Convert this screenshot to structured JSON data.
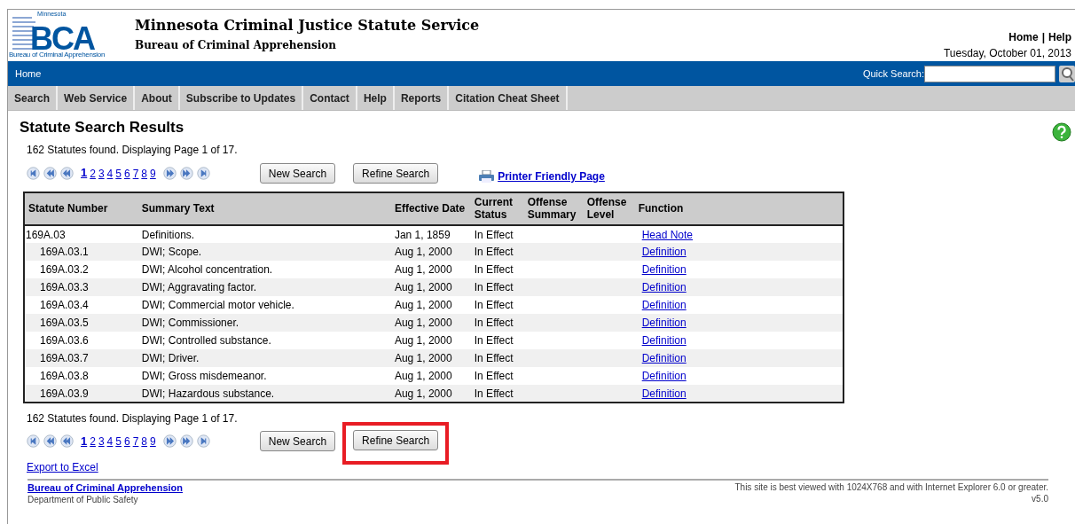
{
  "header": {
    "logo": {
      "top": "Minnesota",
      "letters": "BCA",
      "bottom": "Bureau of Criminal Apprehension"
    },
    "title": "Minnesota Criminal Justice Statute Service",
    "subtitle": "Bureau of Criminal Apprehension",
    "links": [
      "Home",
      "Help"
    ],
    "separator": "|",
    "date": "Tuesday, October 01, 2013"
  },
  "blue_bar": {
    "breadcrumb": "Home",
    "quick_search_label": "Quick Search:"
  },
  "menu": [
    {
      "label": "Search"
    },
    {
      "label": "Web Service"
    },
    {
      "label": "About"
    },
    {
      "label": "Subscribe to Updates"
    },
    {
      "label": "Contact"
    },
    {
      "label": "Help"
    },
    {
      "label": "Reports"
    },
    {
      "label": "Citation Cheat Sheet"
    }
  ],
  "heading": "Statute Search Results",
  "summary_top": "162 Statutes found. Displaying Page 1 of 17.",
  "pages_top": [
    {
      "label": "1",
      "selected": true
    },
    {
      "label": "2",
      "selected": false
    },
    {
      "label": "3",
      "selected": false
    },
    {
      "label": "4",
      "selected": false
    },
    {
      "label": "5",
      "selected": false
    },
    {
      "label": "6",
      "selected": false
    },
    {
      "label": "7",
      "selected": false
    },
    {
      "label": "8",
      "selected": false
    },
    {
      "label": "9",
      "selected": false
    }
  ],
  "buttons_top": [
    {
      "label": "New Search",
      "highlighted": false
    },
    {
      "label": "Refine Search",
      "highlighted": false
    }
  ],
  "printer_link": "Printer Friendly Page",
  "table": {
    "columns": [
      "Statute Number",
      "Summary Text",
      "Effective Date",
      "Current Status",
      "Offense Summary",
      "Offense Level",
      "Function"
    ],
    "rows": [
      {
        "number": "169A.03",
        "summary": "Definitions.",
        "date": "Jan 1, 1859",
        "status": "In Effect",
        "function": "Head Note",
        "children": [
          {
            "number": "169A.03.1",
            "summary": "DWI; Scope.",
            "date": "Aug 1, 2000",
            "status": "In Effect",
            "function": "Definition"
          },
          {
            "number": "169A.03.2",
            "summary": "DWI; Alcohol concentration.",
            "date": "Aug 1, 2000",
            "status": "In Effect",
            "function": "Definition"
          },
          {
            "number": "169A.03.3",
            "summary": "DWI; Aggravating factor.",
            "date": "Aug 1, 2000",
            "status": "In Effect",
            "function": "Definition"
          },
          {
            "number": "169A.03.4",
            "summary": "DWI; Commercial motor vehicle.",
            "date": "Aug 1, 2000",
            "status": "In Effect",
            "function": "Definition"
          },
          {
            "number": "169A.03.5",
            "summary": "DWI; Commissioner.",
            "date": "Aug 1, 2000",
            "status": "In Effect",
            "function": "Definition"
          },
          {
            "number": "169A.03.6",
            "summary": "DWI; Controlled substance.",
            "date": "Aug 1, 2000",
            "status": "In Effect",
            "function": "Definition"
          },
          {
            "number": "169A.03.7",
            "summary": "DWI; Driver.",
            "date": "Aug 1, 2000",
            "status": "In Effect",
            "function": "Definition"
          },
          {
            "number": "169A.03.8",
            "summary": "DWI; Gross misdemeanor.",
            "date": "Aug 1, 2000",
            "status": "In Effect",
            "function": "Definition"
          },
          {
            "number": "169A.03.9",
            "summary": "DWI; Hazardous substance.",
            "date": "Aug 1, 2000",
            "status": "In Effect",
            "function": "Definition"
          }
        ]
      }
    ]
  },
  "summary_bottom": "162 Statutes found. Displaying Page 1 of 17.",
  "pages_bottom": [
    {
      "label": "1",
      "selected": true
    },
    {
      "label": "2",
      "selected": false
    },
    {
      "label": "3",
      "selected": false
    },
    {
      "label": "4",
      "selected": false
    },
    {
      "label": "5",
      "selected": false
    },
    {
      "label": "6",
      "selected": false
    },
    {
      "label": "7",
      "selected": false
    },
    {
      "label": "8",
      "selected": false
    },
    {
      "label": "9",
      "selected": false
    }
  ],
  "buttons_bottom": [
    {
      "label": "New Search",
      "highlighted": false
    },
    {
      "label": "Refine Search",
      "highlighted": true
    }
  ],
  "export_link": "Export to Excel",
  "footer": {
    "org_link": "Bureau of Criminal Apprehension",
    "department": "Department of Public Safety",
    "notice": "This site is best viewed with 1024X768 and with Internet Explorer 6.0 or greater.",
    "version": "v5.0"
  }
}
